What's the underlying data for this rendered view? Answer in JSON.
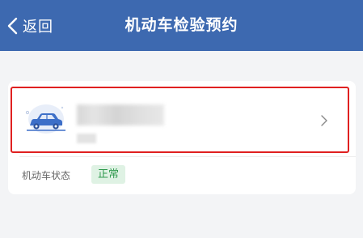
{
  "header": {
    "back_label": "返回",
    "title": "机动车检验预约",
    "background_color": "#3d69b0"
  },
  "vehicle_card": {
    "icon": "car-icon",
    "chevron_icon": "chevron-right-icon",
    "highlight_color": "#e02020",
    "status_label": "机动车状态",
    "status_value": "正常",
    "status_color": "#2f9a4e"
  }
}
